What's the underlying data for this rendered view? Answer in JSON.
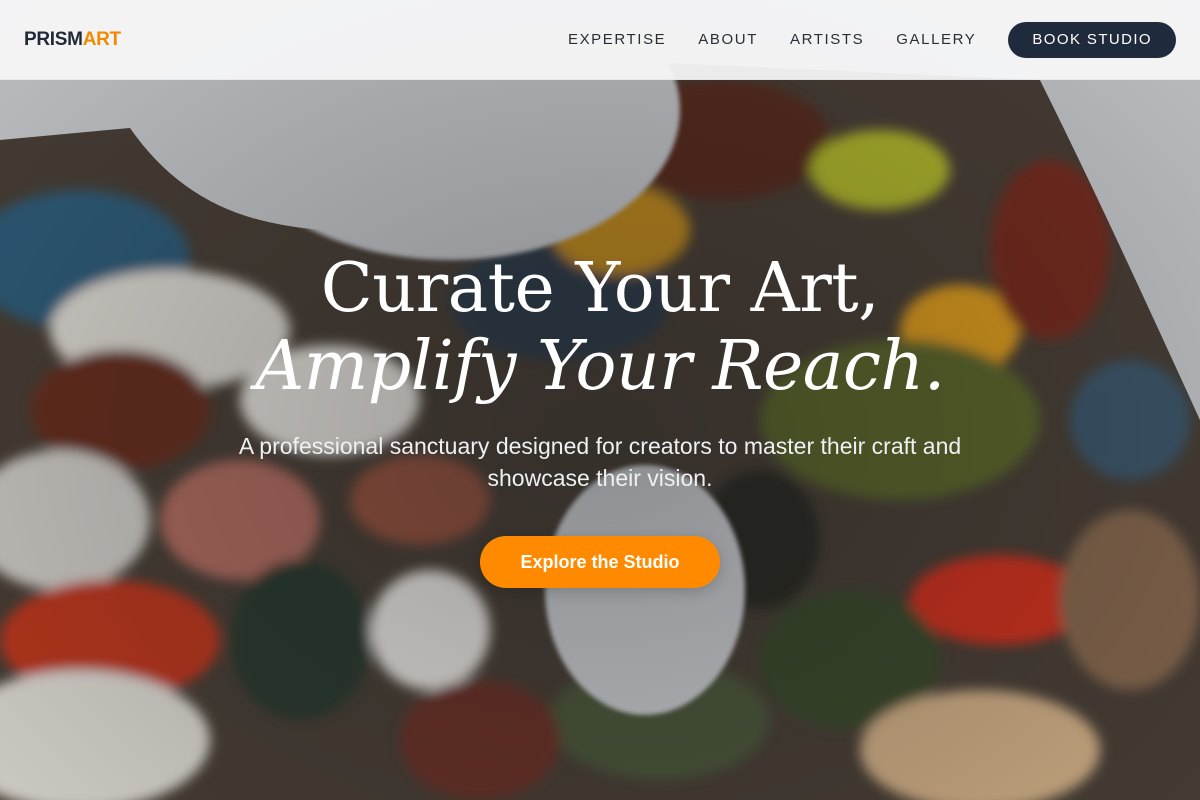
{
  "brand": {
    "part1": "PRISM",
    "part2": "ART",
    "accent_color": "#f08a00"
  },
  "nav": {
    "links": [
      "EXPERTISE",
      "ABOUT",
      "ARTISTS",
      "GALLERY"
    ],
    "cta_label": "BOOK STUDIO"
  },
  "hero": {
    "headline_line1": "Curate Your Art,",
    "headline_line2": "Amplify Your Reach.",
    "subtitle": "A professional sanctuary designed for creators to master their craft and showcase their vision.",
    "cta_label": "Explore the Studio",
    "cta_color": "#ff8a00",
    "background": "oil-paint-palette-photo"
  }
}
